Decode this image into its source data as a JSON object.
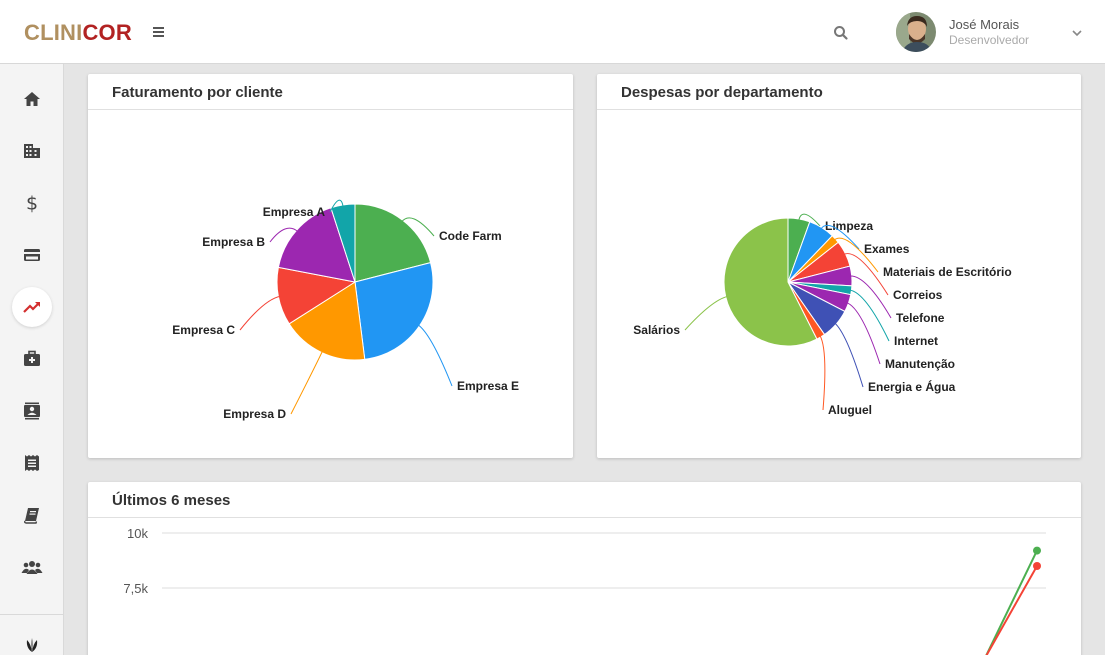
{
  "header": {
    "logo_part1": "CLINI",
    "logo_part2": "COR",
    "user_name": "José Morais",
    "user_role": "Desenvolvedor"
  },
  "colors": {
    "logo_part1": "#b09060",
    "logo_part2": "#b22222",
    "active_nav": "#d32f2f"
  },
  "sidebar": {
    "items": [
      {
        "icon": "home-icon"
      },
      {
        "icon": "building-icon"
      },
      {
        "icon": "dollar-icon"
      },
      {
        "icon": "credit-card-icon"
      },
      {
        "icon": "trending-up-icon",
        "active": true
      },
      {
        "icon": "medical-kit-icon"
      },
      {
        "icon": "contacts-icon"
      },
      {
        "icon": "receipt-icon"
      },
      {
        "icon": "book-icon"
      },
      {
        "icon": "group-icon"
      },
      {
        "icon": "plant-icon"
      }
    ]
  },
  "cards": {
    "faturamento_title": "Faturamento por cliente",
    "despesas_title": "Despesas por departamento",
    "ultimos_title": "Últimos 6 meses"
  },
  "chart_data": [
    {
      "type": "pie",
      "title": "Faturamento por cliente",
      "categories": [
        "Code Farm",
        "Empresa E",
        "Empresa D",
        "Empresa C",
        "Empresa B",
        "Empresa A"
      ],
      "values": [
        21,
        27,
        18,
        12,
        17,
        5
      ],
      "colors": [
        "#4caf50",
        "#2196f3",
        "#ff9800",
        "#f44336",
        "#9c27b0",
        "#12a5a9"
      ]
    },
    {
      "type": "pie",
      "title": "Despesas por departamento",
      "categories": [
        "Limpeza",
        "Exames",
        "Materiais de Escritório",
        "Correios",
        "Telefone",
        "Internet",
        "Manutenção",
        "Energia e Água",
        "Aluguel",
        "Salários"
      ],
      "values": [
        5,
        6,
        2,
        6,
        4.5,
        2,
        4,
        7,
        2,
        52
      ],
      "colors": [
        "#4caf50",
        "#2196f3",
        "#ff9800",
        "#f44336",
        "#9c27b0",
        "#12a5a9",
        "#9c27b0",
        "#3f51b5",
        "#ff5722",
        "#8bc34a"
      ]
    },
    {
      "type": "line",
      "title": "Últimos 6 meses",
      "yticks": [
        "10k",
        "7,5k"
      ],
      "ylim": [
        0,
        10000
      ],
      "series": [
        {
          "color": "#4caf50",
          "values": [
            9200
          ]
        },
        {
          "color": "#f44336",
          "values": [
            8500
          ]
        }
      ]
    }
  ]
}
